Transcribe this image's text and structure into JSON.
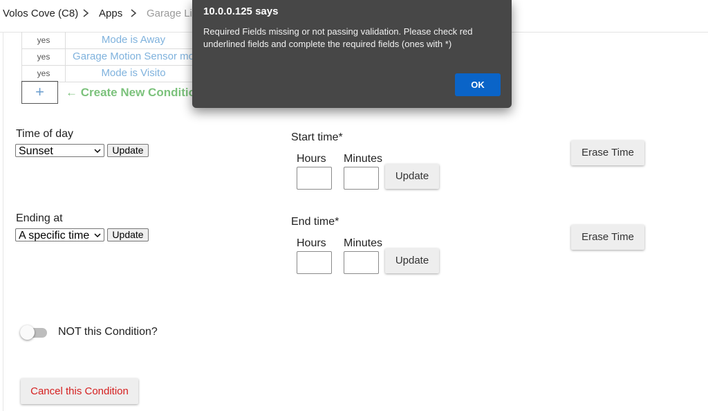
{
  "breadcrumb": {
    "hub": "Volos Cove (C8)",
    "apps": "Apps",
    "current": "Garage Lig"
  },
  "conditions": {
    "rows": [
      {
        "flag": "yes",
        "name": "Mode is Away"
      },
      {
        "flag": "yes",
        "name": "Garage Motion Sensor mo"
      },
      {
        "flag": "yes",
        "name": "Mode is Visito"
      }
    ],
    "add_symbol": "+",
    "create_new_label": "← Create New Conditio"
  },
  "time_of_day": {
    "label": "Time of day",
    "selected": "Sunset",
    "update_label": "Update"
  },
  "ending_at": {
    "label": "Ending at",
    "selected": "A specific time",
    "update_label": "Update"
  },
  "start_time": {
    "label": "Start time*",
    "hours_label": "Hours",
    "minutes_label": "Minutes",
    "hours_value": "",
    "minutes_value": "",
    "update_label": "Update",
    "erase_label": "Erase Time"
  },
  "end_time": {
    "label": "End time*",
    "hours_label": "Hours",
    "minutes_label": "Minutes",
    "hours_value": "",
    "minutes_value": "",
    "update_label": "Update",
    "erase_label": "Erase Time"
  },
  "not_condition": {
    "label": "NOT this Condition?",
    "enabled": false
  },
  "cancel_label": "Cancel this Condition",
  "dialog": {
    "title": "10.0.0.125 says",
    "message": "Required Fields missing or not passing validation. Please check red underlined fields and complete the required fields (ones with *)",
    "ok_label": "OK"
  },
  "colors": {
    "link_blue": "#7fb2dd",
    "create_green": "#7cc27c",
    "cancel_red": "#d52020",
    "dialog_bg": "#474747",
    "ok_blue": "#0a64c8"
  }
}
